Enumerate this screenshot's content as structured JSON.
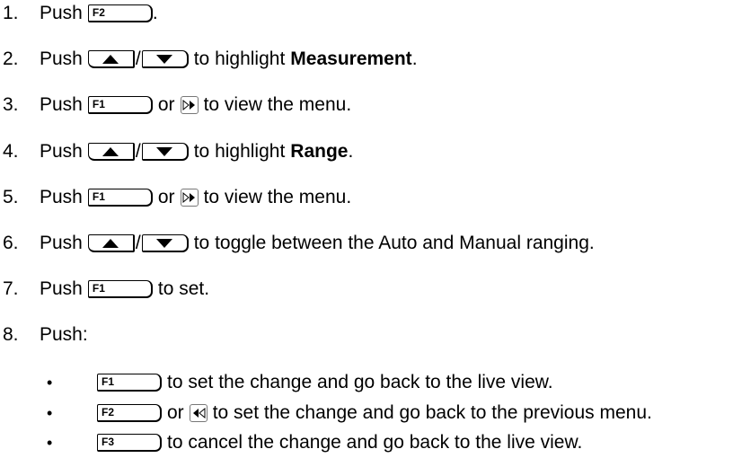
{
  "steps": [
    {
      "num": "1.",
      "push": "Push",
      "key": "F2",
      "tail": "."
    },
    {
      "num": "2.",
      "push": "Push",
      "slash": "/",
      "pre": "to highlight",
      "bold": "Measurement",
      "tail": "."
    },
    {
      "num": "3.",
      "push": "Push",
      "key": "F1",
      "or": "or",
      "tail": "to view the menu."
    },
    {
      "num": "4.",
      "push": "Push",
      "slash": "/",
      "pre": "to highlight",
      "bold": "Range",
      "tail": "."
    },
    {
      "num": "5.",
      "push": "Push",
      "key": "F1",
      "or": "or",
      "tail": "to view the menu."
    },
    {
      "num": "6.",
      "push": "Push",
      "slash": "/",
      "tail": "to toggle between the Auto and Manual ranging."
    },
    {
      "num": "7.",
      "push": "Push",
      "key": "F1",
      "tail": "to set."
    },
    {
      "num": "8.",
      "push": "Push:"
    }
  ],
  "sub_steps": [
    {
      "bullet": "•",
      "key": "F1",
      "tail": "to set the change and go back to the live view."
    },
    {
      "bullet": "•",
      "key": "F2",
      "or": "or",
      "tail": "to set the change and go back to the previous menu."
    },
    {
      "bullet": "•",
      "key": "F3",
      "tail": "to cancel the change and go back to the live view."
    }
  ],
  "icons": {
    "up": "up-arrow-key-icon",
    "down": "down-arrow-key-icon",
    "right": "right-nav-key-icon",
    "back": "back-nav-key-icon"
  }
}
